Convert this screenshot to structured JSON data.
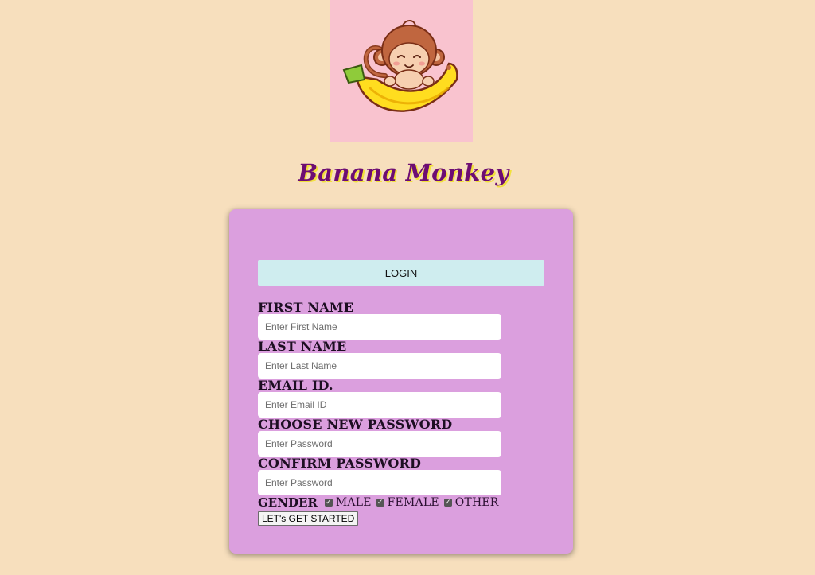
{
  "brand": {
    "title": "Banana Monkey",
    "logo_icon": "monkey-on-banana-icon"
  },
  "form": {
    "login_label": "LOGIN",
    "fields": [
      {
        "label": "FIRST NAME",
        "placeholder": "Enter First Name",
        "value": ""
      },
      {
        "label": "LAST NAME",
        "placeholder": "Enter Last Name",
        "value": ""
      },
      {
        "label": "EMAIL ID.",
        "placeholder": "Enter Email ID",
        "value": ""
      },
      {
        "label": "CHOOSE NEW PASSWORD",
        "placeholder": "Enter Password",
        "value": ""
      },
      {
        "label": "CONFIRM PASSWORD",
        "placeholder": "Enter Password",
        "value": ""
      }
    ],
    "gender": {
      "label": "GENDER",
      "options": [
        {
          "label": "MALE",
          "checked": true
        },
        {
          "label": "FEMALE",
          "checked": true
        },
        {
          "label": "OTHER",
          "checked": true
        }
      ]
    },
    "submit_label": "LET's GET STARTED"
  },
  "colors": {
    "page_background": "#f7dfbd",
    "logo_background": "#f9c3cf",
    "card_background": "#db9fde",
    "login_button": "#cfedef",
    "title_color": "#6d0d73",
    "title_shadow": "#f2e13b"
  }
}
